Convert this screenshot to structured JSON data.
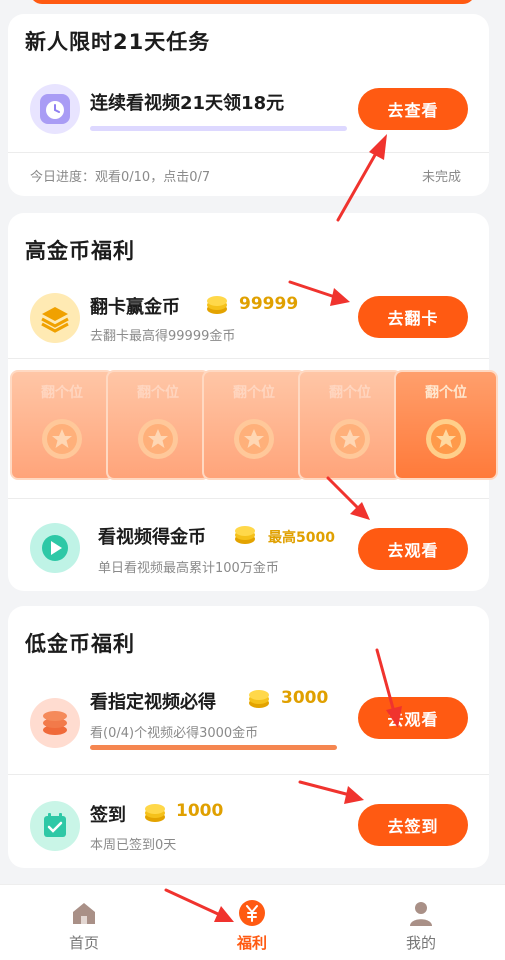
{
  "newbie": {
    "title": "新人限时21天任务",
    "task_title": "连续看视频21天领18元",
    "button": "去查看",
    "progress_text": "今日进度：观看0/10，点击0/7",
    "status": "未完成"
  },
  "high": {
    "title": "高金币福利",
    "flip": {
      "title": "翻卡赢金币",
      "coins": "99999",
      "sub": "去翻卡最高得99999金币",
      "button": "去翻卡",
      "cards": [
        "翻个位",
        "翻个位",
        "翻个位",
        "翻个位",
        "翻个位"
      ]
    },
    "video": {
      "title": "看视频得金币",
      "coins": "最高5000",
      "sub": "单日看视频最高累计100万金币",
      "button": "去观看"
    }
  },
  "low": {
    "title": "低金币福利",
    "watch": {
      "title": "看指定视频必得",
      "coins": "3000",
      "sub": "看(0/4)个视频必得3000金币",
      "button": "去观看",
      "progress": 0
    },
    "signin": {
      "title": "签到",
      "coins": "1000",
      "sub": "本周已签到0天",
      "button": "去签到"
    }
  },
  "tabs": [
    {
      "label": "首页",
      "icon": "home-icon",
      "active": false
    },
    {
      "label": "福利",
      "icon": "yuan-icon",
      "active": true
    },
    {
      "label": "我的",
      "icon": "user-icon",
      "active": false
    }
  ],
  "colors": {
    "accent": "#ff5a12",
    "coin": "#e0a000",
    "flip_card": "#ffa47a"
  }
}
